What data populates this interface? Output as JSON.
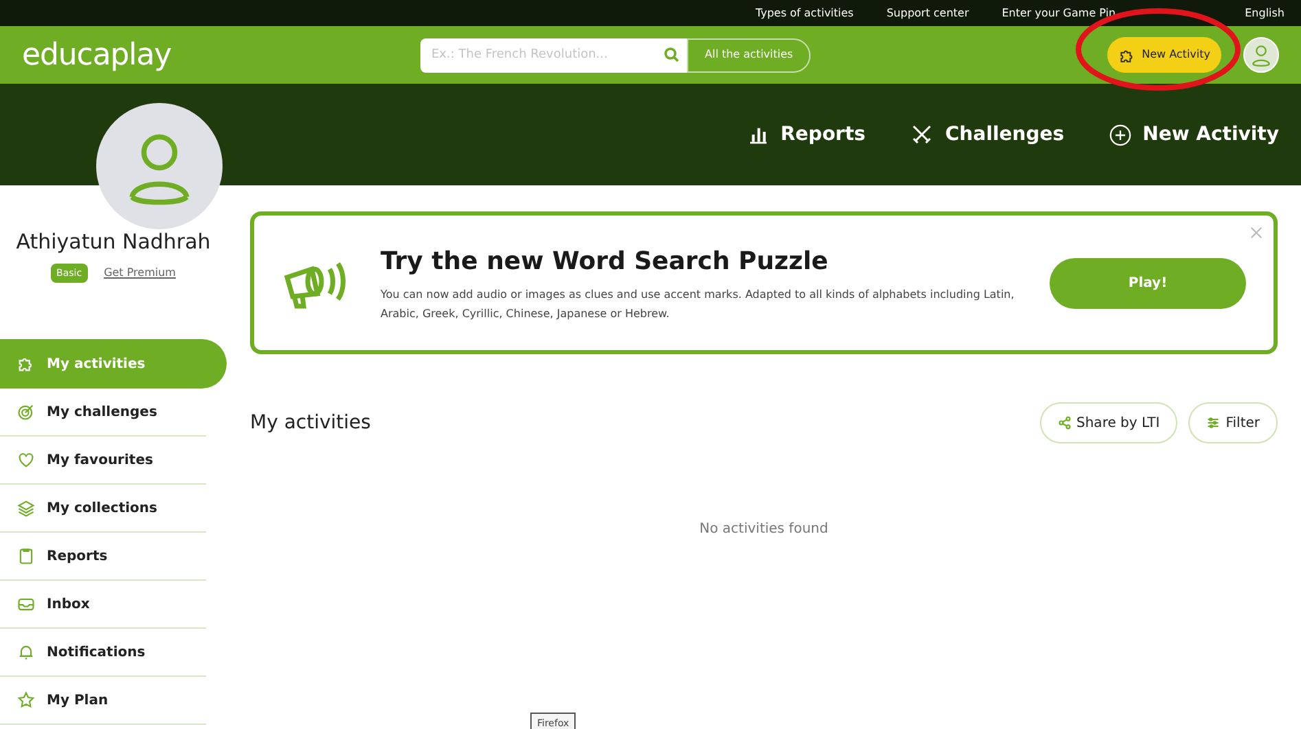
{
  "top_links": [
    "Types of activities",
    "Support center",
    "Enter your Game Pin",
    "English"
  ],
  "header": {
    "logo": "educaplay",
    "search": {
      "placeholder": "Ex.: The French Revolution..."
    },
    "scope": "All the activities",
    "new_activity": "New Activity"
  },
  "banner_nav": [
    "Reports",
    "Challenges",
    "New Activity"
  ],
  "profile": {
    "name": "Athiyatun Nadhrah",
    "plan": "Basic",
    "upgrade": "Get Premium"
  },
  "sidebar": {
    "items": [
      {
        "label": "My activities",
        "selected": true
      },
      {
        "label": "My challenges",
        "selected": false
      },
      {
        "label": "My favourites",
        "selected": false
      },
      {
        "label": "My collections",
        "selected": false
      },
      {
        "label": "Reports",
        "selected": false
      },
      {
        "label": "Inbox",
        "selected": false
      },
      {
        "label": "Notifications",
        "selected": false
      },
      {
        "label": "My Plan",
        "selected": false
      }
    ]
  },
  "promo": {
    "title": "Try the new Word Search Puzzle",
    "text": "You can now add audio or images as clues and use accent marks. Adapted to all kinds of alphabets including Latin, Arabic, Greek, Cyrillic, Chinese, Japanese or Hebrew.",
    "button": "Play!"
  },
  "section": {
    "title": "My activities",
    "buttons": [
      "Share by LTI",
      "Filter"
    ],
    "empty": "No activities found"
  },
  "tooltip": "Firefox"
}
